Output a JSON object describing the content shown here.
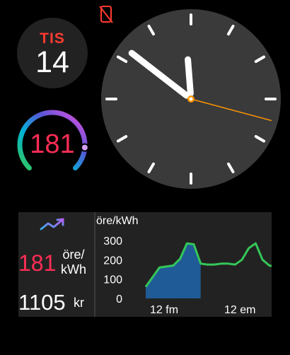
{
  "status": {
    "icon": "phone-disconnected-icon",
    "color": "#ff3b30"
  },
  "date": {
    "weekday": "TIS",
    "day": "14",
    "weekday_color": "#ff3b30"
  },
  "gauge": {
    "value": "181",
    "level": 0.85,
    "color": "#ff2d55"
  },
  "clock": {
    "hour": 11,
    "minute": 51,
    "second": 17.5,
    "accent": "#ff9500"
  },
  "widget": {
    "trend_icon": "trend-up-icon",
    "price_value": "181",
    "price_unit": "öre/\nkWh",
    "cost_value": "1105",
    "cost_unit": "kr"
  },
  "chart_data": {
    "type": "area",
    "ylabel": "öre/kWh",
    "y_ticks": [
      "300",
      "200",
      "100",
      "0"
    ],
    "ylim": [
      0,
      300
    ],
    "x_tick_labels": [
      "12 fm",
      "12 em"
    ],
    "x_hours": [
      0,
      1,
      2,
      3,
      4,
      5,
      6,
      7,
      8,
      9,
      10,
      11,
      12,
      13,
      14,
      15,
      16,
      17,
      18,
      19,
      20,
      21,
      22,
      23
    ],
    "values": [
      60,
      110,
      160,
      165,
      170,
      205,
      285,
      280,
      180,
      175,
      175,
      180,
      180,
      175,
      200,
      260,
      285,
      200,
      170,
      165,
      160,
      155
    ],
    "elapsed_until_index": 8
  }
}
